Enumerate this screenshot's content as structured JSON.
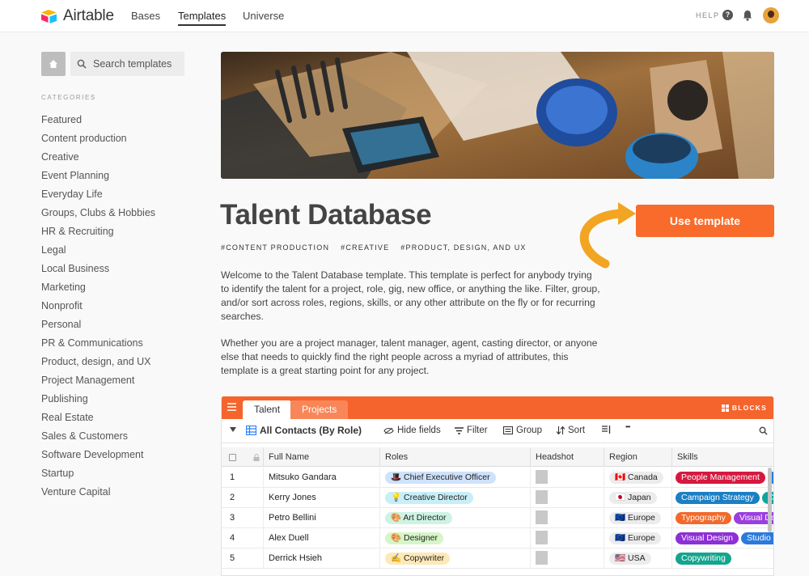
{
  "nav": {
    "brand": "Airtable",
    "links": [
      "Bases",
      "Templates",
      "Universe"
    ],
    "help": "HELP"
  },
  "sidebar": {
    "search_placeholder": "Search templates",
    "categories_heading": "CATEGORIES",
    "categories": [
      "Featured",
      "Content production",
      "Creative",
      "Event Planning",
      "Everyday Life",
      "Groups, Clubs & Hobbies",
      "HR & Recruiting",
      "Legal",
      "Local Business",
      "Marketing",
      "Nonprofit",
      "Personal",
      "PR & Communications",
      "Product, design, and UX",
      "Project Management",
      "Publishing",
      "Real Estate",
      "Sales & Customers",
      "Software Development",
      "Startup",
      "Venture Capital"
    ]
  },
  "template": {
    "title": "Talent Database",
    "tags": [
      "#CONTENT PRODUCTION",
      "#CREATIVE",
      "#PRODUCT, DESIGN, AND UX"
    ],
    "use_button": "Use template",
    "description": [
      "Welcome to the Talent Database template. This template is perfect for anybody trying to identify the talent for a project, role, gig, new office, or anything the like. Filter, group, and/or sort across roles, regions, skills, or any other attribute on the fly or for recurring searches.",
      "Whether you are a project manager, talent manager, agent, casting director, or anyone else that needs to quickly find the right people across a myriad of attributes, this template is a great starting point for any project."
    ]
  },
  "base": {
    "tabs": [
      "Talent",
      "Projects"
    ],
    "blocks_label": "BLOCKS",
    "view_name": "All Contacts (By Role)",
    "toolbar": {
      "hide": "Hide fields",
      "filter": "Filter",
      "group": "Group",
      "sort": "Sort",
      "more": "•••"
    },
    "columns": [
      "Full Name",
      "Roles",
      "Headshot",
      "Region",
      "Skills"
    ],
    "rows": [
      {
        "num": "1",
        "name": "Mitsuko Gandara",
        "role": "🎩 Chief Executive Officer",
        "role_color": "#cfe2fb",
        "region": "🇨🇦 Canada",
        "skills": [
          [
            "People Management",
            "#d6183f"
          ],
          [
            "",
            "#2a7bdc"
          ]
        ]
      },
      {
        "num": "2",
        "name": "Kerry Jones",
        "role": "💡 Creative Director",
        "role_color": "#c8eef7",
        "region": "🇯🇵 Japan",
        "skills": [
          [
            "Campaign Strategy",
            "#1b7fc4"
          ],
          [
            "Cl",
            "#11a59d"
          ]
        ]
      },
      {
        "num": "3",
        "name": "Petro Bellini",
        "role": "🎨 Art Director",
        "role_color": "#cdf3e4",
        "region": "🇪🇺 Europe",
        "skills": [
          [
            "Typography",
            "#f26a2b"
          ],
          [
            "Visual De",
            "#9b3ee0"
          ]
        ]
      },
      {
        "num": "4",
        "name": "Alex Duell",
        "role": "🎨 Designer",
        "role_color": "#d6f5c8",
        "region": "🇪🇺 Europe",
        "skills": [
          [
            "Visual Design",
            "#8d2fd6"
          ],
          [
            "Studio M",
            "#2a7bdc"
          ]
        ]
      },
      {
        "num": "5",
        "name": "Derrick Hsieh",
        "role": "✍️ Copywriter",
        "role_color": "#fde9b8",
        "region": "🇺🇸 USA",
        "skills": [
          [
            "Copywriting",
            "#14a58e"
          ]
        ]
      }
    ]
  },
  "colors": {
    "accent": "#f86b2a",
    "base_header": "#f5642c"
  }
}
